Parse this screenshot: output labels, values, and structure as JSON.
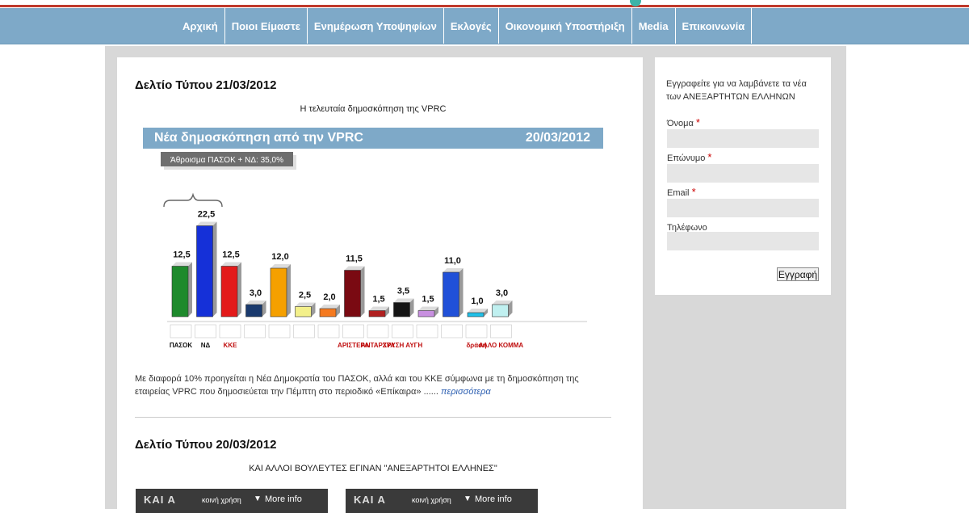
{
  "nav": {
    "items": [
      "Αρχική",
      "Ποιοι Είμαστε",
      "Ενημέρωση Υποψηφίων",
      "Εκλογές",
      "Οικονομική Υποστήριξη",
      "Media",
      "Επικοινωνία"
    ]
  },
  "posts": [
    {
      "title": "Δελτίο Τύπου 21/03/2012",
      "subtitle": "Η τελευταία δημοσκόπηση της VPRC",
      "text": "Με διαφορά 10% προηγείται η Νέα Δημοκρατία του ΠΑΣΟΚ, αλλά και του ΚΚΕ σύμφωνα με τη δημοσκόπηση της εταιρείας VPRC που δημοσιεύεται την Πέμπτη στο περιοδικό «Επίκαιρα» ......",
      "more_link": "περισσότερα"
    },
    {
      "title": "Δελτίο Τύπου 20/03/2012",
      "subtitle": "ΚΑΙ ΑΛΛΟΙ ΒΟΥΛΕΥΤΕΣ ΕΓΙΝΑΝ \"ΑΝΕΞΑΡΤΗΤΟΙ ΕΛΛΗΝΕΣ\""
    }
  ],
  "chart_data": {
    "type": "bar",
    "title": "Νέα δημοσκόπηση από την VPRC",
    "date": "20/03/2012",
    "annotation": "Άθροισμα ΠΑΣΟΚ + ΝΔ: 35,0%",
    "categories": [
      "ΠΑΣΟΚ",
      "ΝΔ",
      "ΚΚΕ",
      "",
      "",
      "",
      "",
      "ΑΡΙΣΤΕΡΑ",
      "ΑΝΤΑΡΣΥΑ",
      "ΧΡΥΣΗ ΑΥΓΗ",
      "",
      "",
      "δράση",
      "ΑΛΛΟ ΚΟΜΜΑ"
    ],
    "values": [
      12.5,
      22.5,
      12.5,
      3.0,
      12.0,
      2.5,
      2.0,
      11.5,
      1.5,
      3.5,
      1.5,
      11.0,
      1.0,
      3.0
    ],
    "value_labels": [
      "12,5",
      "22,5",
      "12,5",
      "3,0",
      "12,0",
      "2,5",
      "2,0",
      "11,5",
      "1,5",
      "3,5",
      "1,5",
      "11,0",
      "1,0",
      "3,0"
    ],
    "colors": [
      "#1e8a2c",
      "#1530d8",
      "#e31a1a",
      "#1a3a6e",
      "#f5a000",
      "#f3f08a",
      "#f57a20",
      "#7a0a12",
      "#b02020",
      "#151515",
      "#c890e0",
      "#2050d8",
      "#20c0e8",
      "#c0f0f0"
    ],
    "ylim": [
      0,
      25
    ]
  },
  "videos": [
    {
      "logo": "ΚΑΙ Α",
      "share": "κοινή χρήση",
      "more": "More info"
    },
    {
      "logo": "ΚΑΙ Α",
      "share": "κοινή χρήση",
      "more": "More info"
    }
  ],
  "sidebar": {
    "intro": "Εγγραφείτε για να λαμβάνετε τα νέα των ΑΝΕΞΑΡΤΗΤΩΝ ΕΛΛΗΝΩΝ",
    "fields": [
      {
        "label": "Όνομα",
        "required": "*"
      },
      {
        "label": "Επώνυμο",
        "required": "*"
      },
      {
        "label": "Email",
        "required": "*"
      },
      {
        "label": "Τηλέφωνο",
        "required": ""
      }
    ],
    "submit": "Εγγραφή"
  }
}
